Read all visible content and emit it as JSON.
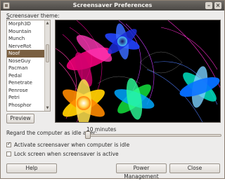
{
  "window": {
    "title": "Screensaver Preferences",
    "menu_icon": "window-menu-icon",
    "minimize_icon": "minimize-icon",
    "close_icon": "close-icon"
  },
  "theme_label": "Screensaver theme:",
  "themes": [
    "Morph3D",
    "Mountain",
    "Munch",
    "NerveRot",
    "Noof",
    "NoseGuy",
    "Pacman",
    "Pedal",
    "Penetrate",
    "Penrose",
    "Petri",
    "Phosphor"
  ],
  "selected_theme": "Noof",
  "preview_button": "Preview",
  "idle": {
    "label": "Regard the computer as idle after:",
    "value": "10 minutes",
    "slider_fraction": 0.0
  },
  "activate_checkbox": {
    "label": "Activate screensaver when computer is idle",
    "checked": true
  },
  "lock_checkbox": {
    "label": "Lock screen when screensaver is active",
    "checked": false
  },
  "buttons": {
    "help": "Help",
    "power": "Power Management",
    "close": "Close"
  },
  "colors": {
    "selection": "#7a5f41",
    "preview_bg": "#000000"
  }
}
